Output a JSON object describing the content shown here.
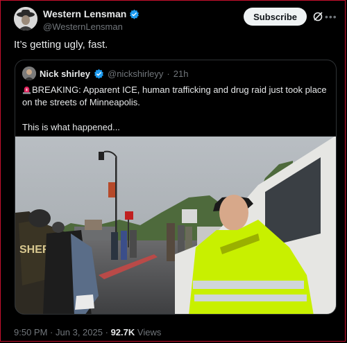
{
  "author": {
    "display_name": "Western Lensman",
    "handle": "@WesternLensman"
  },
  "subscribe_label": "Subscribe",
  "tweet_text": "It’s getting ugly, fast.",
  "quoted": {
    "display_name": "Nick shirley",
    "handle": "@nickshirleyy",
    "separator": "·",
    "time_ago": "21h",
    "line1": "BREAKING: Apparent ICE, human trafficking and drug raid just took place on the streets of Minneapolis.",
    "line2": "This is what happened...",
    "image_text": "SHERIFF"
  },
  "meta": {
    "time": "9:50 PM",
    "dot": "·",
    "date": "Jun 3, 2025",
    "views_count": "92.7K",
    "views_label": "Views"
  },
  "colors": {
    "verified": "#1d9bf0",
    "accent_border": "#c8102e",
    "vest": "#c8f000"
  }
}
